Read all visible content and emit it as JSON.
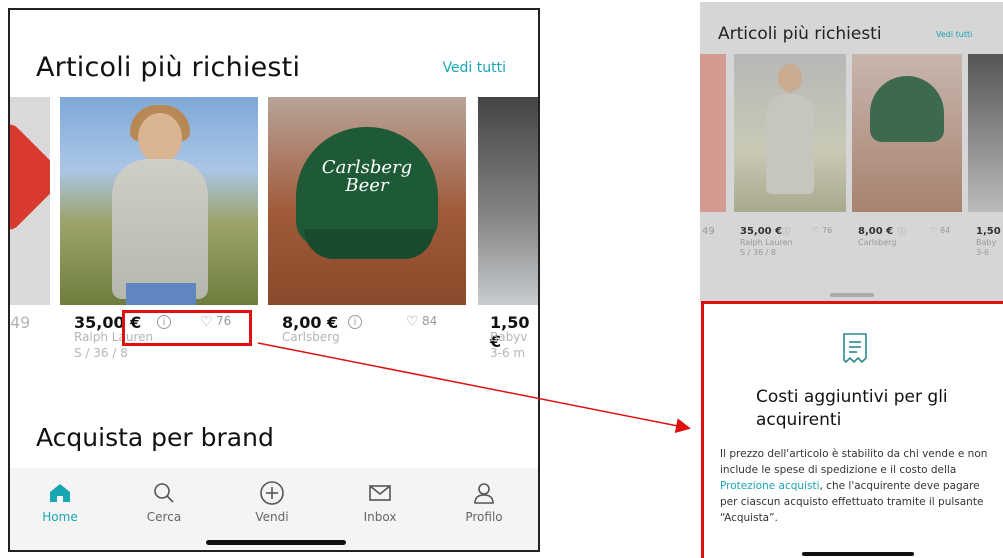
{
  "left_screen": {
    "section_title": "Articoli più richiesti",
    "see_all": "Vedi tutti",
    "partial_left_price": "49",
    "items": [
      {
        "price": "35,00 €",
        "likes": "76",
        "brand": "Ralph Lauren",
        "size": "S / 36 / 8"
      },
      {
        "price": "8,00 €",
        "likes": "84",
        "brand": "Carlsberg",
        "size": ""
      },
      {
        "price": "1,50 €",
        "brand": "Babyv",
        "size": "3-6 m"
      }
    ],
    "cap_text": "Carlsberg Beer",
    "brand_section_title": "Acquista per brand",
    "tabs": [
      {
        "label": "Home",
        "icon": "home-icon",
        "active": true
      },
      {
        "label": "Cerca",
        "icon": "search-icon"
      },
      {
        "label": "Vendi",
        "icon": "plus-circle-icon"
      },
      {
        "label": "Inbox",
        "icon": "mail-icon"
      },
      {
        "label": "Profilo",
        "icon": "profile-icon"
      }
    ]
  },
  "right_screen": {
    "section_title": "Articoli più richiesti",
    "see_all": "Vedi tutti",
    "partial_left_price": "49",
    "items": [
      {
        "price": "35,00 €",
        "likes": "76",
        "brand": "Ralph Lauren",
        "size": "S / 36 / 8"
      },
      {
        "price": "8,00 €",
        "likes": "84",
        "brand": "Carlsberg"
      },
      {
        "price": "1,50",
        "brand": "Baby",
        "size": "3-6"
      }
    ],
    "sheet": {
      "title": "Costi aggiuntivi per gli acquirenti",
      "body_before": "Il prezzo dell'articolo è stabilito da chi vende e non include le spese di spedizione e il costo della ",
      "body_link": "Protezione acquisti",
      "body_after": ", che l'acquirente deve pagare per ciascun acquisto effettuato tramite il pulsante “Acquista”."
    }
  },
  "colors": {
    "accent": "#19a6b3",
    "highlight": "#e01010"
  }
}
